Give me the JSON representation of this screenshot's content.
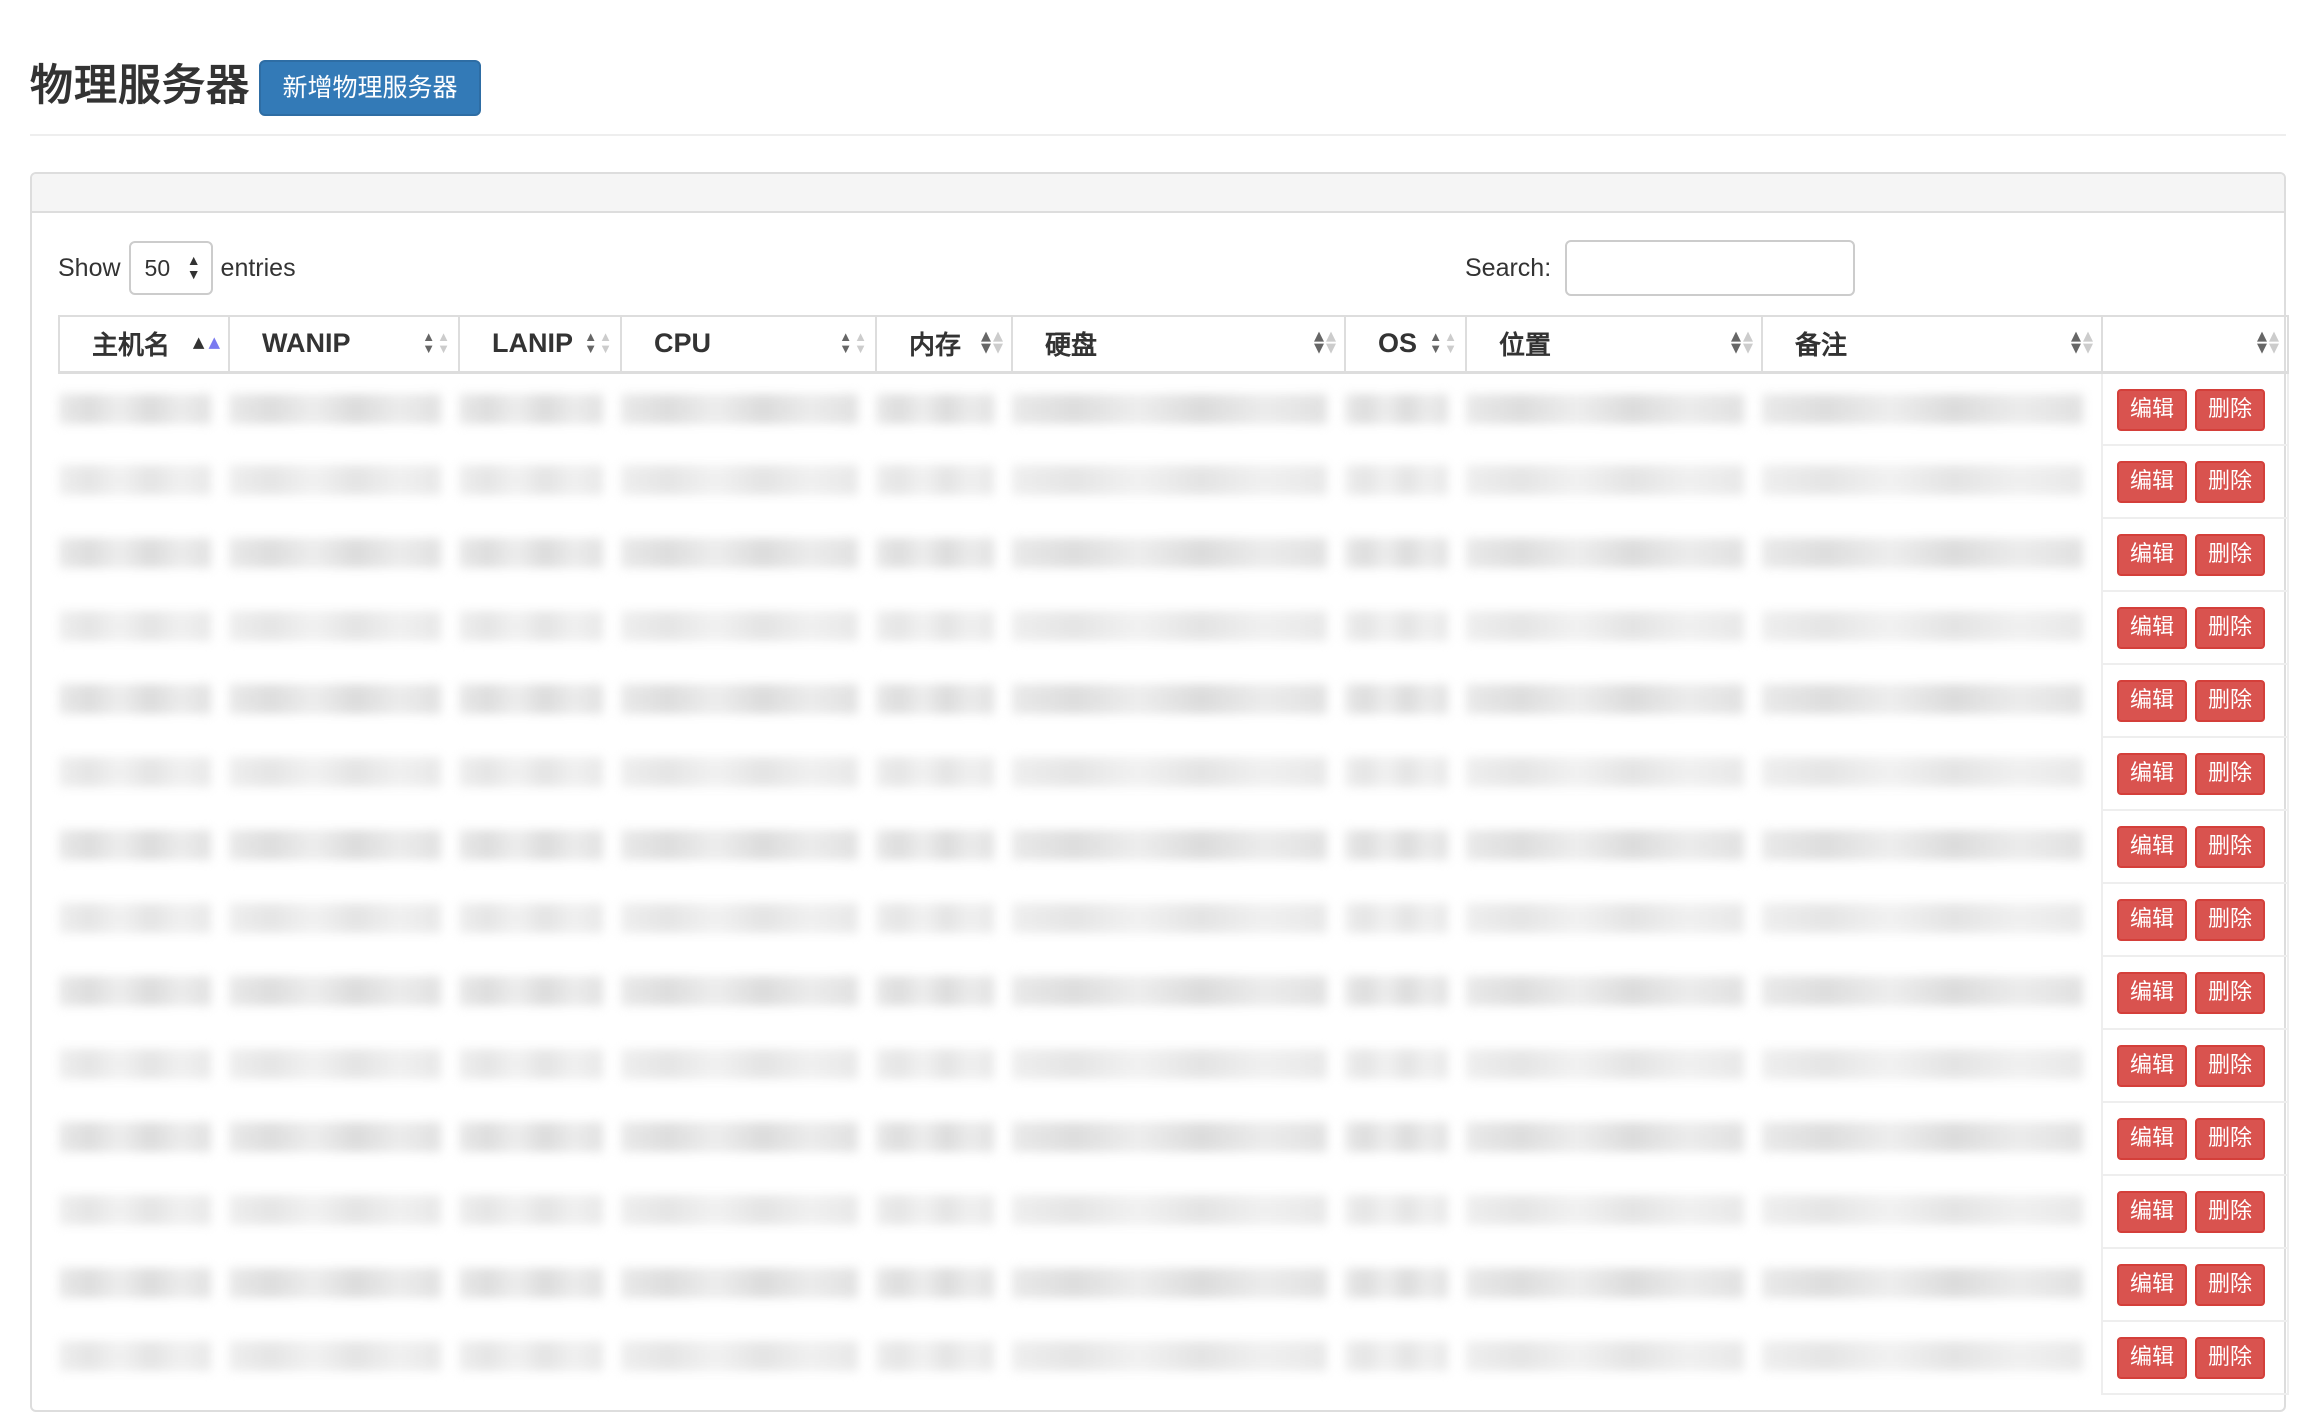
{
  "page": {
    "title": "物理服务器",
    "add_button": "新增物理服务器"
  },
  "controls": {
    "show_label": "Show",
    "entries_value": "50",
    "entries_label": "entries",
    "search_label": "Search:",
    "search_value": ""
  },
  "table": {
    "columns": [
      "主机名",
      "WANIP",
      "LANIP",
      "CPU",
      "内存",
      "硬盘",
      "OS",
      "位置",
      "备注",
      ""
    ],
    "sorted_column": "主机名",
    "sort_direction": "ascending",
    "row_count_visible": 14,
    "actions": {
      "edit": "编辑",
      "delete": "删除"
    }
  },
  "colors": {
    "primary": "#337ab7",
    "danger": "#d9534f"
  }
}
